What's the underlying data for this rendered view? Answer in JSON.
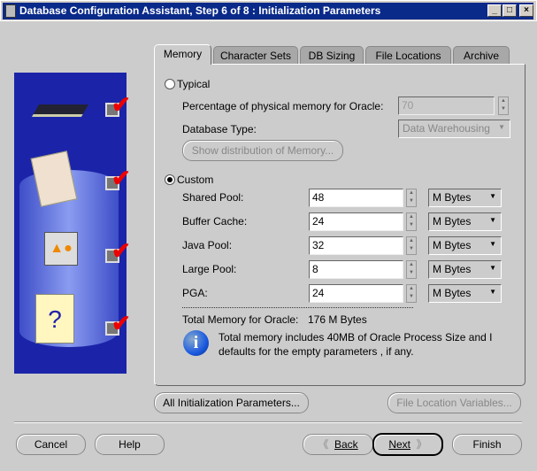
{
  "window": {
    "title": "Database Configuration Assistant, Step 6 of 8 : Initialization Parameters",
    "minimize": "_",
    "maximize": "□",
    "close": "×"
  },
  "steps": [
    "memory",
    "folders",
    "objects",
    "help-docs"
  ],
  "tabs": [
    {
      "label": "Memory",
      "active": true
    },
    {
      "label": "Character Sets"
    },
    {
      "label": "DB Sizing"
    },
    {
      "label": "File Locations"
    },
    {
      "label": "Archive"
    }
  ],
  "typical": {
    "label": "Typical",
    "selected": false,
    "pct_label": "Percentage of physical memory for Oracle:",
    "pct_value": "70",
    "dbtype_label": "Database Type:",
    "dbtype_value": "Data Warehousing",
    "show_button": "Show distribution of Memory..."
  },
  "custom": {
    "label": "Custom",
    "selected": true,
    "rows": [
      {
        "label": "Shared Pool:",
        "value": "48",
        "unit": "M Bytes"
      },
      {
        "label": "Buffer Cache:",
        "value": "24",
        "unit": "M Bytes"
      },
      {
        "label": "Java Pool:",
        "value": "32",
        "unit": "M Bytes"
      },
      {
        "label": "Large Pool:",
        "value": "8",
        "unit": "M Bytes"
      },
      {
        "label": "PGA:",
        "value": "24",
        "unit": "M Bytes"
      }
    ],
    "total_label": "Total Memory for Oracle:",
    "total_value": "176 M Bytes",
    "info_line1": "Total memory includes 40MB of Oracle Process Size and I",
    "info_line2": "defaults for the empty parameters , if any."
  },
  "buttons": {
    "all_params": "All Initialization Parameters...",
    "file_vars": "File Location Variables...",
    "cancel": "Cancel",
    "help": "Help",
    "back": "Back",
    "next": "Next",
    "finish": "Finish"
  },
  "colors": {
    "titlebar": "#0a2a8a",
    "panel": "#1b24a8",
    "check": "#e00000"
  }
}
